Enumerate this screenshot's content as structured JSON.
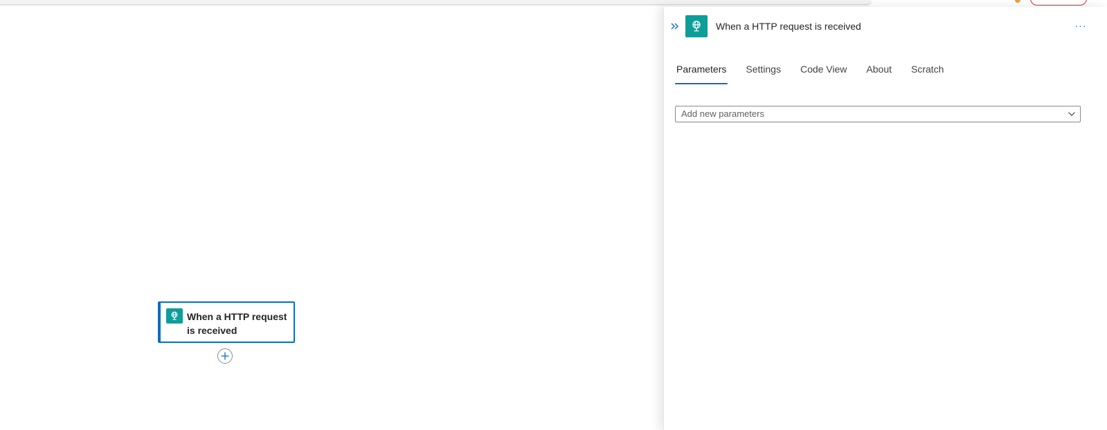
{
  "canvas": {
    "node": {
      "title": "When a HTTP request is received",
      "icon": "http-request-icon",
      "accent": "#0f6cbd",
      "icon_bg": "#0f9d9a"
    },
    "add_step_icon": "plus-icon"
  },
  "panel": {
    "title": "When a HTTP request is received",
    "icon": "http-request-icon",
    "collapse_icon": "double-chevron-right-icon",
    "more_label": "···",
    "tabs": [
      {
        "label": "Parameters",
        "active": true
      },
      {
        "label": "Settings",
        "active": false
      },
      {
        "label": "Code View",
        "active": false
      },
      {
        "label": "About",
        "active": false
      },
      {
        "label": "Scratch",
        "active": false
      }
    ],
    "parameters_dropdown": {
      "placeholder": "Add new parameters",
      "icon": "chevron-down-icon"
    }
  }
}
